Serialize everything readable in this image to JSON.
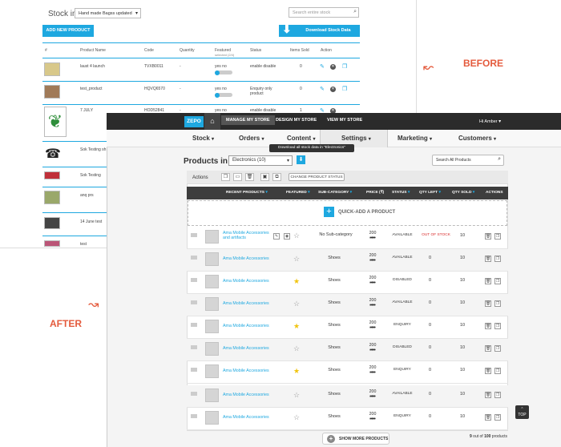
{
  "labels": {
    "before": "BEFORE",
    "after": "AFTER"
  },
  "before": {
    "title": "Stock in",
    "store_select": "Hand made Bagss updated",
    "search_placeholder": "Search entire stock",
    "add_btn": "ADD NEW PRODUCT",
    "download_btn": "Download Stock Data",
    "headers": {
      "hash": "#",
      "name": "Product Name",
      "code": "Code",
      "qty": "Quantity",
      "featured": "Featured",
      "featured_sub": "selected (2/4)",
      "status": "Status",
      "sold": "Items Sold",
      "action": "Action"
    },
    "rows": [
      {
        "name": "laust 4 launch",
        "code": "TVXB0011",
        "qty": "-",
        "featured": "yes    no",
        "status": "enable    disable",
        "sold": "0"
      },
      {
        "name": "test_product",
        "code": "HQVQ6570",
        "qty": "-",
        "featured": "yes    no",
        "status": "Enquiry only product",
        "sold": "0"
      },
      {
        "name": "7 JULY",
        "code": "HOD52841",
        "qty": "-",
        "featured": "yes    no",
        "status": "enable    disable",
        "sold": "1"
      },
      {
        "name": "Sok Testing sh"
      },
      {
        "name": "Sok Testing"
      },
      {
        "name": "anq prs"
      },
      {
        "name": "14 June test"
      },
      {
        "name": "test"
      }
    ]
  },
  "after": {
    "logo": "ZEPO",
    "home_icon": "home-icon",
    "topnav": [
      "MANAGE MY STORE",
      "DESIGN MY STORE",
      "VIEW MY STORE"
    ],
    "user": "Hi Amber",
    "menu": [
      "Stock",
      "Orders",
      "Content",
      "Settings",
      "Marketing",
      "Customers"
    ],
    "tooltip": "Download all stock data in \"Electronics\"",
    "products_in": "Products in",
    "category": "Electronics (10)",
    "search": "Search All  Products",
    "actions_label": "Actions",
    "change_status": "CHANGE PRODUCT STATUS",
    "headers": [
      "RECENT PRODUCTS",
      "FEATURED",
      "SUB-CATEGORY",
      "PRICE (₹)",
      "STATUS",
      "QTY LEFT",
      "QTY SOLD",
      "ACTIONS"
    ],
    "quick_add": "QUICK-ADD A PRODUCT",
    "rows": [
      {
        "name": "Ama Mobile Accessories and artifacts",
        "featured": false,
        "sub": "No Sub-category",
        "price": "200",
        "mrp": "300",
        "status": "AVAILABLE",
        "status2": "OUT OF STOCK",
        "qty_left": "",
        "sold": "10"
      },
      {
        "name": "Ama Mobile Accessories",
        "featured": false,
        "sub": "Shoes",
        "price": "200",
        "mrp": "300",
        "status": "AVAILABLE",
        "qty_left": "0",
        "sold": "10"
      },
      {
        "name": "Ama Mobile Accessories",
        "featured": true,
        "sub": "Shoes",
        "price": "200",
        "mrp": "300",
        "status": "DISABLED",
        "qty_left": "0",
        "sold": "10"
      },
      {
        "name": "Ama Mobile Accessories",
        "featured": false,
        "sub": "Shoes",
        "price": "200",
        "mrp": "300",
        "status": "AVAILABLE",
        "qty_left": "0",
        "sold": "10"
      },
      {
        "name": "Ama Mobile Accessories",
        "featured": true,
        "sub": "Shoes",
        "price": "200",
        "mrp": "300",
        "status": "ENQUIRY",
        "qty_left": "0",
        "sold": "10"
      },
      {
        "name": "Ama Mobile Accessories",
        "featured": false,
        "sub": "Shoes",
        "price": "200",
        "mrp": "300",
        "status": "DISABLED",
        "qty_left": "0",
        "sold": "10"
      },
      {
        "name": "Ama Mobile Accessories",
        "featured": true,
        "sub": "Shoes",
        "price": "200",
        "mrp": "300",
        "status": "ENQUIRY",
        "qty_left": "0",
        "sold": "10"
      },
      {
        "name": "Ama Mobile Accessories",
        "featured": false,
        "sub": "Shoes",
        "price": "200",
        "mrp": "300",
        "status": "AVAILABLE",
        "qty_left": "0",
        "sold": "10"
      },
      {
        "name": "Ama Mobile Accessories",
        "featured": false,
        "sub": "Shoes",
        "price": "200",
        "mrp": "300",
        "status": "ENQUIRY",
        "qty_left": "0",
        "sold": "10"
      }
    ],
    "show_more": "SHOW MORE PRODUCTS",
    "count_a": "9",
    "count_b": " out of ",
    "count_c": "100",
    "count_d": " products",
    "top_btn": "TOP"
  }
}
